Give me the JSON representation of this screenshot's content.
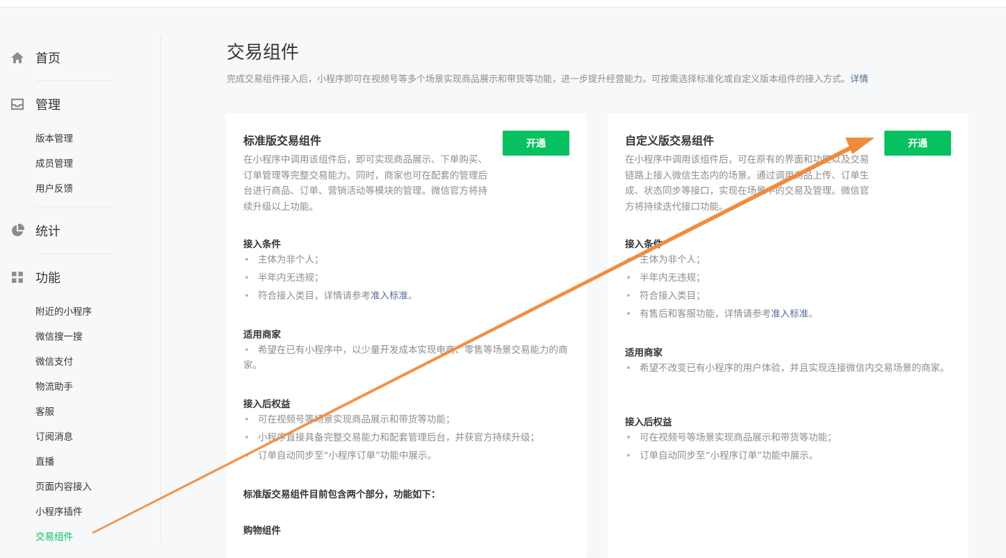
{
  "sidebar": {
    "home": "首页",
    "manage": "管理",
    "manage_items": [
      "版本管理",
      "成员管理",
      "用户反馈"
    ],
    "stats": "统计",
    "features": "功能",
    "feature_items": [
      "附近的小程序",
      "微信搜一搜",
      "微信支付",
      "物流助手",
      "客服",
      "订阅消息",
      "直播",
      "页面内容接入",
      "小程序插件",
      "交易组件"
    ],
    "active_item": "交易组件"
  },
  "main": {
    "title": "交易组件",
    "desc": "完成交易组件接入后，小程序即可在视频号等多个场景实现商品展示和带货等功能，进一步提升经营能力。可按需选择标准化或自定义版本组件的接入方式。",
    "desc_link": "详情"
  },
  "cards": {
    "standard": {
      "title": "标准版交易组件",
      "button": "开通",
      "desc": "在小程序中调用该组件后，即可实现商品展示、下单购买、订单管理等完整交易能力。同时，商家也可在配套的管理后台进行商品、订单、营销活动等模块的管理。微信官方将持续升级以上功能。",
      "cond_title": "接入条件",
      "cond": [
        "主体为非个人；",
        "半年内无违规；",
        "符合接入类目，详情请参考"
      ],
      "cond_link": "准入标准",
      "cond_tail": "。",
      "merchant_title": "适用商家",
      "merchant": "希望在已有小程序中，以少量开发成本实现电商、零售等场景交易能力的商家。",
      "benefit_title": "接入后权益",
      "benefits": [
        "可在视频号等场景实现商品展示和带货等功能；",
        "小程序直接具备完整交易能力和配套管理后台，并获官方持续升级；",
        "订单自动同步至“小程序订单”功能中展示。"
      ],
      "parts_title": "标准版交易组件目前包含两个部分，功能如下：",
      "cart_title": "购物组件"
    },
    "custom": {
      "title": "自定义版交易组件",
      "button": "开通",
      "desc": "在小程序中调用该组件后，可在原有的界面和功能以及交易链路上接入微信生态内的场景。通过调用商品上传、订单生成、状态同步等接口，实现在场景中的交易及管理。微信官方将持续迭代接口功能。",
      "cond_title": "接入条件",
      "cond": [
        "主体为非个人；",
        "半年内无违规；",
        "符合接入类目；",
        "有售后和客服功能，详情请参考"
      ],
      "cond_link": "准入标准",
      "cond_tail": "。",
      "merchant_title": "适用商家",
      "merchant": "希望不改变已有小程序的用户体验，并且实现连接微信内交易场景的商家。",
      "benefit_title": "接入后权益",
      "benefits": [
        "可在视频号等场景实现商品展示和带货等功能；",
        "订单自动同步至“小程序订单”功能中展示。"
      ]
    }
  },
  "colors": {
    "accent": "#07c160",
    "link": "#576b95",
    "arrow": "#f08a3c"
  }
}
